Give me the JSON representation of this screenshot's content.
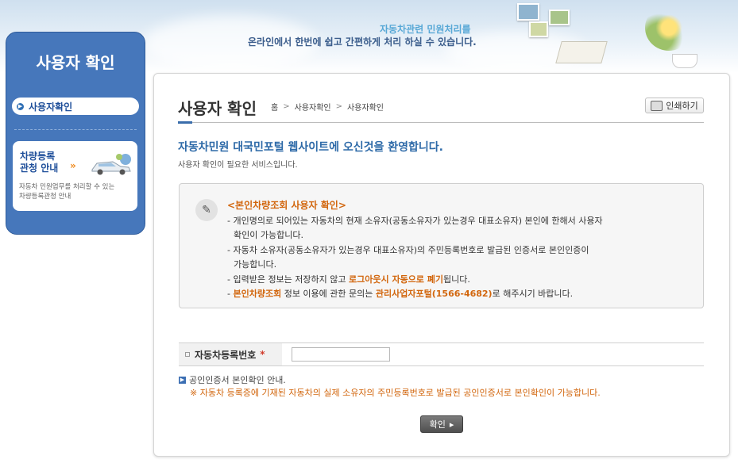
{
  "banner": {
    "slogan_line1": "자동차관련 민원처리를",
    "slogan_line2": "온라인에서 한번에 쉽고 간편하게 처리 하실 수 있습니다."
  },
  "sidebar": {
    "title": "사용자 확인",
    "menu": [
      {
        "label": "사용자확인",
        "active": true
      }
    ],
    "promo": {
      "title_line1": "차량등록",
      "title_line2": "관청 안내",
      "arrow": "»",
      "desc_line1": "자동차 민원업무를 처리할 수 있는",
      "desc_line2": "차량등록관청 안내"
    }
  },
  "header": {
    "title": "사용자 확인",
    "breadcrumb": [
      "홈",
      "사용자확인",
      "사용자확인"
    ],
    "breadcrumb_sep": ">",
    "print_label": "인쇄하기"
  },
  "welcome": {
    "headline": "자동차민원 대국민포털 웹사이트에 오신것을 환영합니다.",
    "subtext": "사용자 확인이 필요한 서비스입니다."
  },
  "notice": {
    "heading": "<본인차량조회 사용자 확인>",
    "line1": "- 개인명의로 되어있는 자동차의 현재 소유자(공동소유자가 있는경우 대표소유자) 본인에 한해서 사용자",
    "line1b": "확인이 가능합니다.",
    "line2": "- 자동차 소유자(공동소유자가 있는경우 대표소유자)의 주민등록번호로 발급된 인증서로 본인인증이",
    "line2b": "가능합니다.",
    "line3_pre": "- 입력받은 정보는 저장하지 않고 ",
    "line3_hl": "로그아웃시 자동으로 폐기",
    "line3_post": "됩니다.",
    "line4_pre": "- ",
    "line4_hl1": "본인차량조회",
    "line4_mid": " 정보 이용에 관한 문의는 ",
    "line4_hl2": "관리사업자포털(1566-4682)",
    "line4_post": "로 해주시기 바랍니다."
  },
  "form": {
    "label": "자동차등록번호",
    "required_mark": "*",
    "value": "",
    "placeholder": ""
  },
  "info": {
    "title": "공인인증서 본인확인 안내.",
    "desc": "※ 자동차 등록증에 기재된 자동차의 실제 소유자의 주민등록번호로 발급된 공인인증서로 본인확인이 가능합니다."
  },
  "confirm_label": "확인",
  "colors": {
    "accent_blue": "#2e6aa8",
    "sidebar_blue": "#4677bb",
    "highlight_orange": "#d2660d"
  }
}
